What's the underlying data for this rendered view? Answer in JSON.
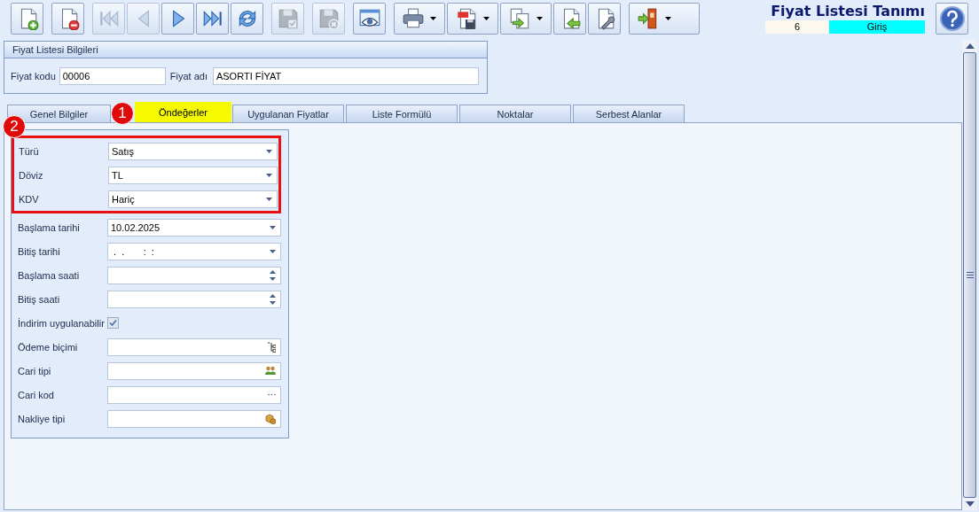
{
  "toolbar": [
    {
      "buttons": [
        {
          "kind": "new",
          "disabled": false,
          "dropdown": false
        }
      ]
    },
    {
      "buttons": [
        {
          "kind": "delete",
          "disabled": false,
          "dropdown": false
        }
      ]
    },
    {
      "buttons": [
        {
          "kind": "first",
          "disabled": true,
          "dropdown": false
        },
        {
          "kind": "previous",
          "disabled": true,
          "dropdown": false
        },
        {
          "kind": "next",
          "disabled": false,
          "dropdown": false
        },
        {
          "kind": "last",
          "disabled": false,
          "dropdown": false
        },
        {
          "kind": "refresh",
          "disabled": false,
          "dropdown": false
        }
      ]
    },
    {
      "buttons": [
        {
          "kind": "save",
          "disabled": true,
          "dropdown": false
        }
      ]
    },
    {
      "buttons": [
        {
          "kind": "cancel",
          "disabled": true,
          "dropdown": false
        }
      ]
    },
    {
      "buttons": [
        {
          "kind": "preview",
          "disabled": false,
          "dropdown": false
        }
      ]
    },
    {
      "buttons": [
        {
          "kind": "print",
          "disabled": false,
          "dropdown": true
        },
        {
          "kind": "pdf",
          "disabled": false,
          "dropdown": true
        },
        {
          "kind": "copy",
          "disabled": false,
          "dropdown": true
        },
        {
          "kind": "import",
          "disabled": false,
          "dropdown": false
        },
        {
          "kind": "settings",
          "disabled": false,
          "dropdown": false
        }
      ]
    },
    {
      "buttons": [
        {
          "kind": "exit",
          "disabled": false,
          "dropdown": true
        }
      ]
    }
  ],
  "header": {
    "title": "Fiyat Listesi Tanımı",
    "record_number": "6",
    "mode": "Giriş"
  },
  "info_panel": {
    "title": "Fiyat Listesi Bilgileri",
    "fields": [
      {
        "label": "Fiyat kodu",
        "value": "00006"
      },
      {
        "label": "Fiyat adı",
        "value": "ASORTI FİYAT"
      }
    ]
  },
  "tabs": [
    {
      "label": "Genel Bilgiler",
      "selected": false
    },
    {
      "label": "Öndeğerler",
      "selected": true
    },
    {
      "label": "Uygulanan Fiyatlar",
      "selected": false
    },
    {
      "label": "Liste Formülü",
      "selected": false
    },
    {
      "label": "Noktalar",
      "selected": false
    },
    {
      "label": "Serbest Alanlar",
      "selected": false
    }
  ],
  "markers": [
    {
      "label": "1"
    },
    {
      "label": "2"
    }
  ],
  "form": {
    "highlighted": [
      {
        "label": "Türü",
        "kind": "combo",
        "value": "Satış"
      },
      {
        "label": "Döviz",
        "kind": "combo",
        "value": "TL"
      },
      {
        "label": "KDV",
        "kind": "combo",
        "value": "Hariç"
      }
    ],
    "fields": [
      {
        "label": "Başlama tarihi",
        "kind": "combo",
        "value": "10.02.2025"
      },
      {
        "label": "Bitiş tarihi",
        "kind": "combo",
        "value": " .  .       :  :"
      },
      {
        "label": "Başlama saati",
        "kind": "spin"
      },
      {
        "label": "Bitiş saati",
        "kind": "spin"
      },
      {
        "label": "İndirim uygulanabilir",
        "kind": "checkbox",
        "checked": true
      },
      {
        "label": "Ödeme biçimi",
        "kind": "tree"
      },
      {
        "label": "Cari tipi",
        "kind": "people"
      },
      {
        "label": "Cari kod",
        "kind": "ellipsis"
      },
      {
        "label": "Nakliye tipi",
        "kind": "box"
      }
    ]
  }
}
